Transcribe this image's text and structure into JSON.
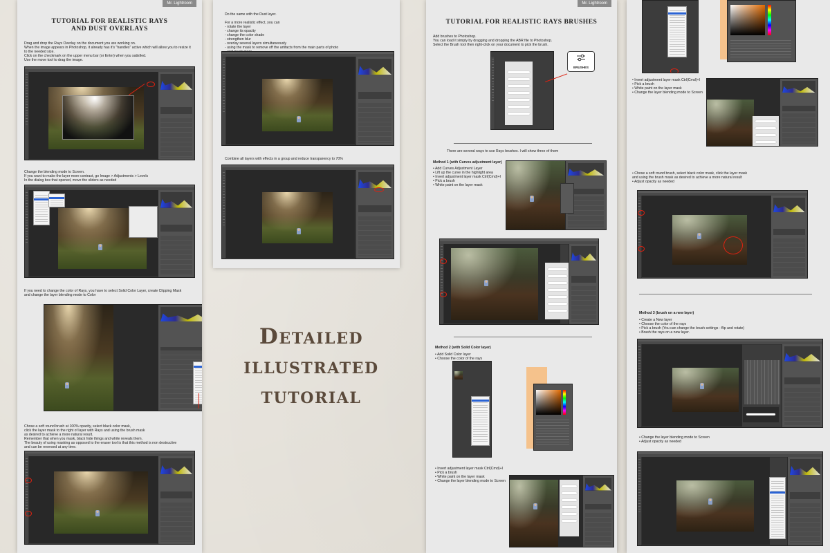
{
  "brand": "Mr. Lightroom",
  "center_title": [
    "Detailed",
    "illustrated",
    "tutorial"
  ],
  "page1": {
    "title": [
      "TUTORIAL FOR REALISTIC RAYS",
      "AND DUST OVERLAYS"
    ],
    "step1": "Drag and drop the Rays Overlay on the document you are working on.\nWhen the image appears in Photoshop, it already has it's \"handles\" active which will allow you to resize it\nto the needed size.\nClick on the checkmark on the upper menu bar (or Enter) when you satisfied.\nUse the move tool to drag the image.",
    "step2": "Change the blending mode to Screen.\nIf you want to make the layer more contrast, go Image > Adjustments > Levels\nIn the dialog box that opened, move the sliders as needed",
    "step3": "If you need to change the color of Rays, you have to select Solid Color Layer, create Clipping Mask\nand change the layer blending mode to Color",
    "step4": "Chose a soft round brush at 100% opacity, select black color mask,\nclick the layer mask to the right of layer with Rays  and using the brush mask\nas desired to achieve a more natural result.\nRemember that when you mask, black hide things and white reveals them.\nThe beauty of using masking as opposed to the eraser tool is that this method is non destructive\nand can be reversed at any time."
  },
  "page2": {
    "step1": "Do the same with the Dust layer.",
    "step1b": "For a more realistic effect, you can\n- rotate the layer\n- change its opacity\n- change the color shade\n- strengthen blur\n- overlay several layers simultaneously\n- using the mask to remove off the artifacts from the main parts of photo\n- and much more....",
    "step2": "Combine all layers with effects in a group and reduce transparency to 70%"
  },
  "page3": {
    "title": "TUTORIAL FOR REALISTIC RAYS BRUSHES",
    "intro": "Add brushes to Photoshop.\nYou can load it simply by dragging and dropping the ABR file to Photoshop.\nSelect the Brush tool then right-click on your document to pick the brush.",
    "badge": "BRUSHES",
    "ways": "There are several ways to use Rays brushes. I will show three of them",
    "method1_title": "Method 1 (with Curves adjustment layer)",
    "method1": "• Add Curves Adjustment Layer\n• Lift up the curve in the highlight area\n• Invert adjustment layer mask Ctrl(Cmd)+I\n• Pick a brush\n• White paint on the layer mask",
    "method2_title": "Method 2 (with Solid Color layer)",
    "method2": "• Add Solid Color layer\n• Choose the color of the rays",
    "method2b": "• Invert adjustment layer mask Ctrl(Cmd)+I\n• Pick a brush\n• White paint on the layer mask\n• Change the layer blending mode to Screen"
  },
  "page4": {
    "step1": "• Invert adjustment layer mask Ctrl(Cmd)+I\n• Pick a brush\n• White paint on the layer mask\n• Change the layer blending mode to Screen",
    "step2": "• Chose a soft round brush, select black color mask, click the layer mask\nand using the brush mask as desired to achieve a more natural result\n• Adjust opacity as needed",
    "method3_title": "Method 3 (brush on a new layer)",
    "method3": "• Create a New layer\n• Choose the color of the rays\n• Pick a brush (You can change the brush settings - flip and rotate)\n• Brush the rays on a new layer.",
    "step4": "• Change the layer blending mode to Screen\n• Adjust opacity as needed"
  }
}
